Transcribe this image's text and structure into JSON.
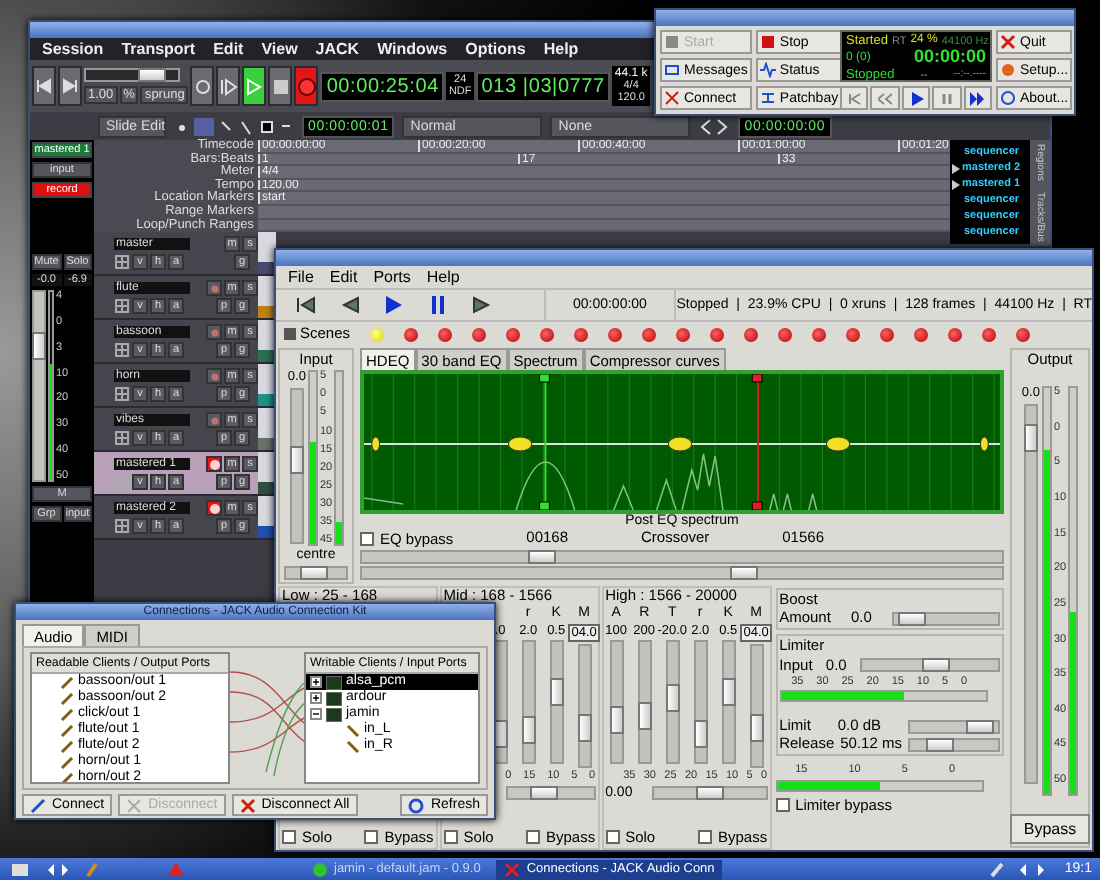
{
  "ardour": {
    "menu": [
      "Session",
      "Transport",
      "Edit",
      "View",
      "JACK",
      "Windows",
      "Options",
      "Help"
    ],
    "transport": {
      "zoom": "1.00",
      "zoom_unit": "%",
      "shuttle_mode": "sprung",
      "shuttle": {
        "level": 0.8
      },
      "play_active": true,
      "record_active": true,
      "clock": "00:00:25:04",
      "fps": "24",
      "fps_mode": "NDF",
      "bbt": "013 |03|0777",
      "sample_rate": "44.1 k",
      "meter": "4/4",
      "tempo": "120.0"
    },
    "toolbar": {
      "edit_mode": "Slide Edit",
      "edit_clock": "00:00:00:01",
      "snap_type": "Normal",
      "snap_mode": "None",
      "nudge_clock": "00:00:00:00"
    },
    "rulers": [
      {
        "label": "Timecode",
        "marks": [
          "00:00:00:00",
          "00:00:20:00",
          "00:00:40:00",
          "00:01:00:00",
          "00:01:20"
        ]
      },
      {
        "label": "Bars:Beats",
        "marks": [
          "1",
          "17",
          "33"
        ]
      },
      {
        "label": "Meter",
        "marks": [
          "4/4"
        ]
      },
      {
        "label": "Tempo",
        "marks": [
          "120.00"
        ]
      },
      {
        "label": "Location Markers",
        "marks": [
          "start"
        ]
      },
      {
        "label": "Range Markers"
      },
      {
        "label": "Loop/Punch Ranges"
      }
    ],
    "strip": {
      "name": "mastered 1",
      "input": "input",
      "record": "record",
      "mute": "Mute",
      "solo": "Solo",
      "gain": "-0.0",
      "peak": "-6.9",
      "scale": [
        "4",
        "0",
        "3",
        "10",
        "20",
        "30",
        "40",
        "50"
      ],
      "fader": {
        "level": 0.75
      },
      "meter": {
        "level": 0.62
      },
      "m": "M",
      "group": "Grp",
      "io": "input"
    },
    "tracks": [
      {
        "name": "master",
        "kind": "bus",
        "selected": false,
        "color": "#4a4a70",
        "top_buttons": [
          "m",
          "s"
        ],
        "bottom_buttons": [
          "v",
          "h",
          "a"
        ],
        "right_buttons": [
          "g"
        ]
      },
      {
        "name": "flute",
        "kind": "track",
        "armed": false,
        "selected": false,
        "color": "#c08018",
        "top_buttons": [
          "m",
          "s"
        ],
        "bottom_buttons": [
          "v",
          "h",
          "a"
        ],
        "right_buttons": [
          "p",
          "g"
        ]
      },
      {
        "name": "bassoon",
        "kind": "track",
        "armed": false,
        "selected": false,
        "color": "#2a7050",
        "top_buttons": [
          "m",
          "s"
        ],
        "bottom_buttons": [
          "v",
          "h",
          "a"
        ],
        "right_buttons": [
          "p",
          "g"
        ]
      },
      {
        "name": "horn",
        "kind": "track",
        "armed": false,
        "selected": false,
        "color": "#209088",
        "top_buttons": [
          "m",
          "s"
        ],
        "bottom_buttons": [
          "v",
          "h",
          "a"
        ],
        "right_buttons": [
          "p",
          "g"
        ]
      },
      {
        "name": "vibes",
        "kind": "track",
        "armed": false,
        "selected": false,
        "color": "#6a706a",
        "top_buttons": [
          "m",
          "s"
        ],
        "bottom_buttons": [
          "v",
          "h",
          "a"
        ],
        "right_buttons": [
          "p",
          "g"
        ]
      },
      {
        "name": "mastered 1",
        "kind": "track",
        "armed": true,
        "selected": true,
        "color": "#305040",
        "top_buttons": [
          "m",
          "s"
        ],
        "bottom_buttons": [
          "v",
          "h",
          "a"
        ],
        "right_buttons": [
          "p",
          "g"
        ]
      },
      {
        "name": "mastered 2",
        "kind": "track",
        "armed": true,
        "selected": false,
        "color": "#2050b0",
        "top_buttons": [
          "m",
          "s"
        ],
        "bottom_buttons": [
          "v",
          "h",
          "a"
        ],
        "right_buttons": [
          "p",
          "g"
        ]
      }
    ],
    "track_list": [
      {
        "name": "sequencer",
        "expandable": false
      },
      {
        "name": "mastered 2",
        "expandable": true
      },
      {
        "name": "mastered 1",
        "expandable": true
      },
      {
        "name": "sequencer",
        "expandable": false
      },
      {
        "name": "sequencer",
        "expandable": false
      },
      {
        "name": "sequencer",
        "expandable": false
      }
    ],
    "side_tabs": [
      "Regions",
      "Tracks/Bus"
    ]
  },
  "qjackctl": {
    "left_buttons": [
      {
        "label": "Start",
        "disabled": true
      },
      {
        "label": "Stop",
        "disabled": false
      },
      {
        "label": "Messages",
        "disabled": false
      },
      {
        "label": "Status",
        "disabled": false
      },
      {
        "label": "Connect",
        "disabled": false
      },
      {
        "label": "Patchbay",
        "disabled": false
      }
    ],
    "right_buttons": [
      "Quit",
      "Setup...",
      "About..."
    ],
    "display": {
      "state": "Started",
      "rt": "RT",
      "dsp": "24 %",
      "rate": "44100 Hz",
      "xruns": "0 (0)",
      "time": "00:00:00",
      "transport": "Stopped",
      "bpm": "--",
      "frame": "--:--.----"
    }
  },
  "jamin": {
    "menu": [
      "File",
      "Edit",
      "Ports",
      "Help"
    ],
    "time": "00:00:00:00",
    "status": "Stopped  |  23.9% CPU  |  0 xruns  |  128 frames  |  44100 Hz  |  RT",
    "scenes_label": "Scenes",
    "scenes": [
      {
        "selected": true
      },
      {
        "selected": false
      },
      {
        "selected": false
      },
      {
        "selected": false
      },
      {
        "selected": false
      },
      {
        "selected": false
      },
      {
        "selected": false
      },
      {
        "selected": false
      },
      {
        "selected": false
      },
      {
        "selected": false
      },
      {
        "selected": false
      },
      {
        "selected": false
      },
      {
        "selected": false
      },
      {
        "selected": false
      },
      {
        "selected": false
      },
      {
        "selected": false
      },
      {
        "selected": false
      },
      {
        "selected": false
      },
      {
        "selected": false
      },
      {
        "selected": false
      }
    ],
    "input": {
      "title": "Input",
      "value": "0.0",
      "scale": [
        "5",
        "0",
        "5",
        "10",
        "15",
        "20",
        "25",
        "30",
        "35",
        "45"
      ],
      "fader": {
        "level": 0.55
      },
      "meters": [
        {
          "level": 0.6
        },
        {
          "level": 0.13
        }
      ],
      "pan": "centre",
      "pan_slider": {
        "level": 0.45
      }
    },
    "tabs": [
      {
        "label": "HDEQ",
        "selected": true
      },
      {
        "label": "30 band EQ",
        "selected": false
      },
      {
        "label": "Spectrum",
        "selected": false
      },
      {
        "label": "Compressor curves",
        "selected": false
      }
    ],
    "graph_label": "Post EQ spectrum",
    "eq_bypass": {
      "label": "EQ bypass",
      "checked": false
    },
    "low_crossover": "00168",
    "crossover_label": "Crossover",
    "high_crossover": "01566",
    "crossover_sliders": [
      {
        "level": 0.27
      },
      {
        "level": 0.6
      }
    ],
    "bands": [
      {
        "label": "Low : 25 - 168",
        "solo": {
          "label": "Solo",
          "checked": false
        },
        "bypass": {
          "label": "Bypass",
          "checked": false
        }
      },
      {
        "label": "Mid : 168 - 1566",
        "columns": [
          {
            "value": ".0",
            "level": 0.15
          },
          {
            "header": "r",
            "value": "2.0",
            "level": 0.2
          },
          {
            "header": "K",
            "value": "0.5",
            "level": 0.6
          },
          {
            "header": "M",
            "value": "04.0",
            "level": 0.25
          }
        ],
        "scale": [
          "0",
          "15",
          "10",
          "5",
          "0"
        ],
        "slider": {
          "level": 0.4
        },
        "solo": {
          "label": "Solo",
          "checked": false
        },
        "bypass": {
          "label": "Bypass",
          "checked": false
        }
      },
      {
        "label": "High : 1566 - 20000",
        "columns": [
          {
            "header": "A",
            "value": "100",
            "level": 0.3
          },
          {
            "header": "R",
            "value": "200",
            "level": 0.35
          },
          {
            "header": "T",
            "value": "-20.0",
            "level": 0.55
          },
          {
            "header": "r",
            "value": "2.0",
            "level": 0.15
          },
          {
            "header": "K",
            "value": "0.5",
            "level": 0.6
          },
          {
            "header": "M",
            "value": "04.0",
            "level": 0.25
          }
        ],
        "scale": [
          "35",
          "30",
          "25",
          "20",
          "15",
          "10",
          "5",
          "0"
        ],
        "value": "0.00",
        "slider": {
          "level": 0.5
        },
        "solo": {
          "label": "Solo",
          "checked": false
        },
        "bypass": {
          "label": "Bypass",
          "checked": false
        }
      }
    ],
    "boost": {
      "title": "Boost",
      "amount_label": "Amount",
      "amount": "0.0",
      "slider": {
        "level": 0.05
      }
    },
    "limiter": {
      "title": "Limiter",
      "input_label": "Input",
      "input": "0.0",
      "input_slider": {
        "level": 0.55
      },
      "scale": [
        "35",
        "30",
        "25",
        "20",
        "15",
        "10",
        "5",
        "0"
      ],
      "meter": {
        "level": 0.6
      },
      "limit_label": "Limit",
      "limit": "0.0 dB",
      "limit_slider": {
        "level": 0.92
      },
      "release_label": "Release",
      "release": "50.12 ms",
      "release_slider": {
        "level": 0.28
      },
      "scale2": [
        "15",
        "10",
        "5",
        "0"
      ],
      "meter2": {
        "level": 0.5
      },
      "bypass": {
        "label": "Limiter bypass",
        "checked": false
      }
    },
    "output": {
      "title": "Output",
      "value": "0.0",
      "scale": [
        "5",
        "0",
        "5",
        "10",
        "15",
        "20",
        "25",
        "30",
        "35",
        "40",
        "45",
        "50"
      ],
      "fader": {
        "level": 0.95
      },
      "meters": [
        {
          "level": 0.85
        },
        {
          "level": 0.45
        }
      ],
      "button": "Bypass"
    }
  },
  "connections": {
    "title": "Connections - JACK Audio Connection Kit",
    "tabs": [
      {
        "label": "Audio",
        "selected": true
      },
      {
        "label": "MIDI",
        "selected": false
      }
    ],
    "readable_header": "Readable Clients / Output Ports",
    "readable": [
      "bassoon/out 1",
      "bassoon/out 2",
      "click/out 1",
      "flute/out 1",
      "flute/out 2",
      "horn/out 1",
      "horn/out 2"
    ],
    "writable_header": "Writable Clients / Input Ports",
    "writable": [
      {
        "name": "alsa_pcm",
        "selected": true,
        "expanded": false
      },
      {
        "name": "ardour",
        "selected": false,
        "expanded": false
      },
      {
        "name": "jamin",
        "selected": false,
        "expanded": true,
        "children": [
          {
            "name": "in_L"
          },
          {
            "name": "in_R"
          }
        ]
      }
    ],
    "buttons": [
      {
        "label": "Connect",
        "disabled": false
      },
      {
        "label": "Disconnect",
        "disabled": true
      },
      {
        "label": "Disconnect All",
        "disabled": false
      },
      {
        "label": "Refresh",
        "disabled": false
      }
    ]
  },
  "taskbar": {
    "tasks": [
      {
        "label": "jamin - default.jam - 0.9.0",
        "active": false
      },
      {
        "label": "Connections - JACK Audio Conn",
        "active": true
      }
    ],
    "clock": "19:1"
  }
}
